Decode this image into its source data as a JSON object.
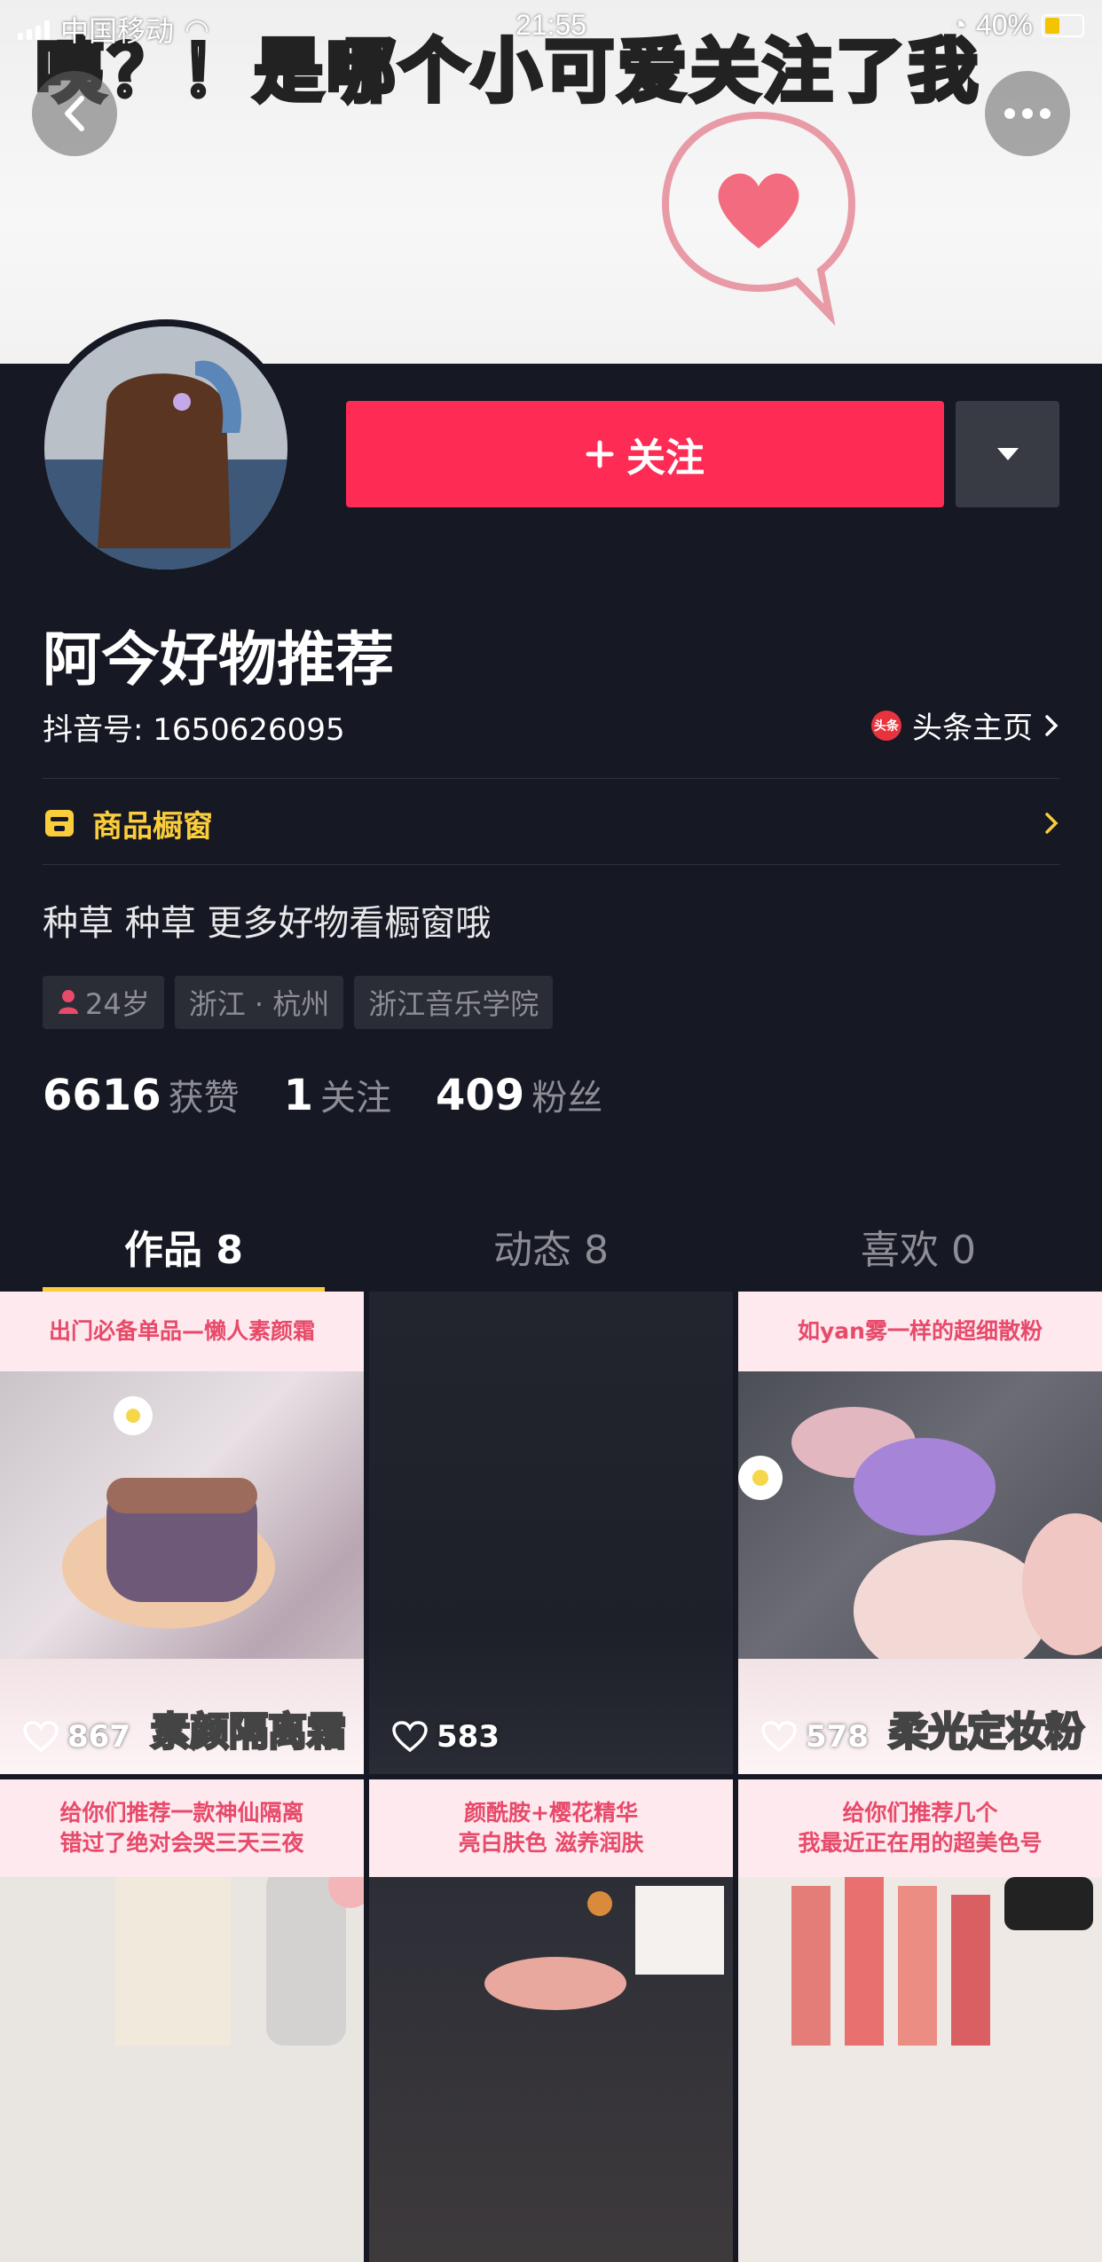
{
  "status_bar": {
    "carrier": "中国移动",
    "time": "21:55",
    "battery": "40%"
  },
  "banner": {
    "text": "咦？！是哪个小可爱关注了我"
  },
  "profile": {
    "follow_label": "关注",
    "name": "阿今好物推荐",
    "douyin_id": "抖音号: 1650626095",
    "toutiao_label": "头条主页",
    "toutiao_badge": "头条",
    "shop_label": "商品橱窗",
    "bio": "种草 种草 更多好物看橱窗哦",
    "tags": [
      "24岁",
      "浙江 · 杭州",
      "浙江音乐学院"
    ],
    "stats": [
      {
        "num": "6616",
        "label": "获赞"
      },
      {
        "num": "1",
        "label": "关注"
      },
      {
        "num": "409",
        "label": "粉丝"
      }
    ]
  },
  "tabs": [
    {
      "label": "作品 8"
    },
    {
      "label": "动态 8"
    },
    {
      "label": "喜欢 0"
    }
  ],
  "videos": [
    {
      "caption": "出门必备单品—懒人素颜霜",
      "title": "素颜隔离霜",
      "likes": "867"
    },
    {
      "caption": "",
      "title": "",
      "likes": "583"
    },
    {
      "caption": "如yan雾一样的超细散粉",
      "title": "柔光定妆粉",
      "likes": "578"
    },
    {
      "caption": "给你们推荐一款神仙隔离\n错过了绝对会哭三天三夜",
      "title": "",
      "likes": ""
    },
    {
      "caption": "颜酰胺+樱花精华\n亮白肤色  滋养润肤",
      "title": "",
      "likes": ""
    },
    {
      "caption": "给你们推荐几个\n我最近正在用的超美色号",
      "title": "",
      "likes": ""
    }
  ],
  "colors": {
    "accent": "#fe2c55",
    "shop": "#facd3a",
    "background": "#161823"
  }
}
